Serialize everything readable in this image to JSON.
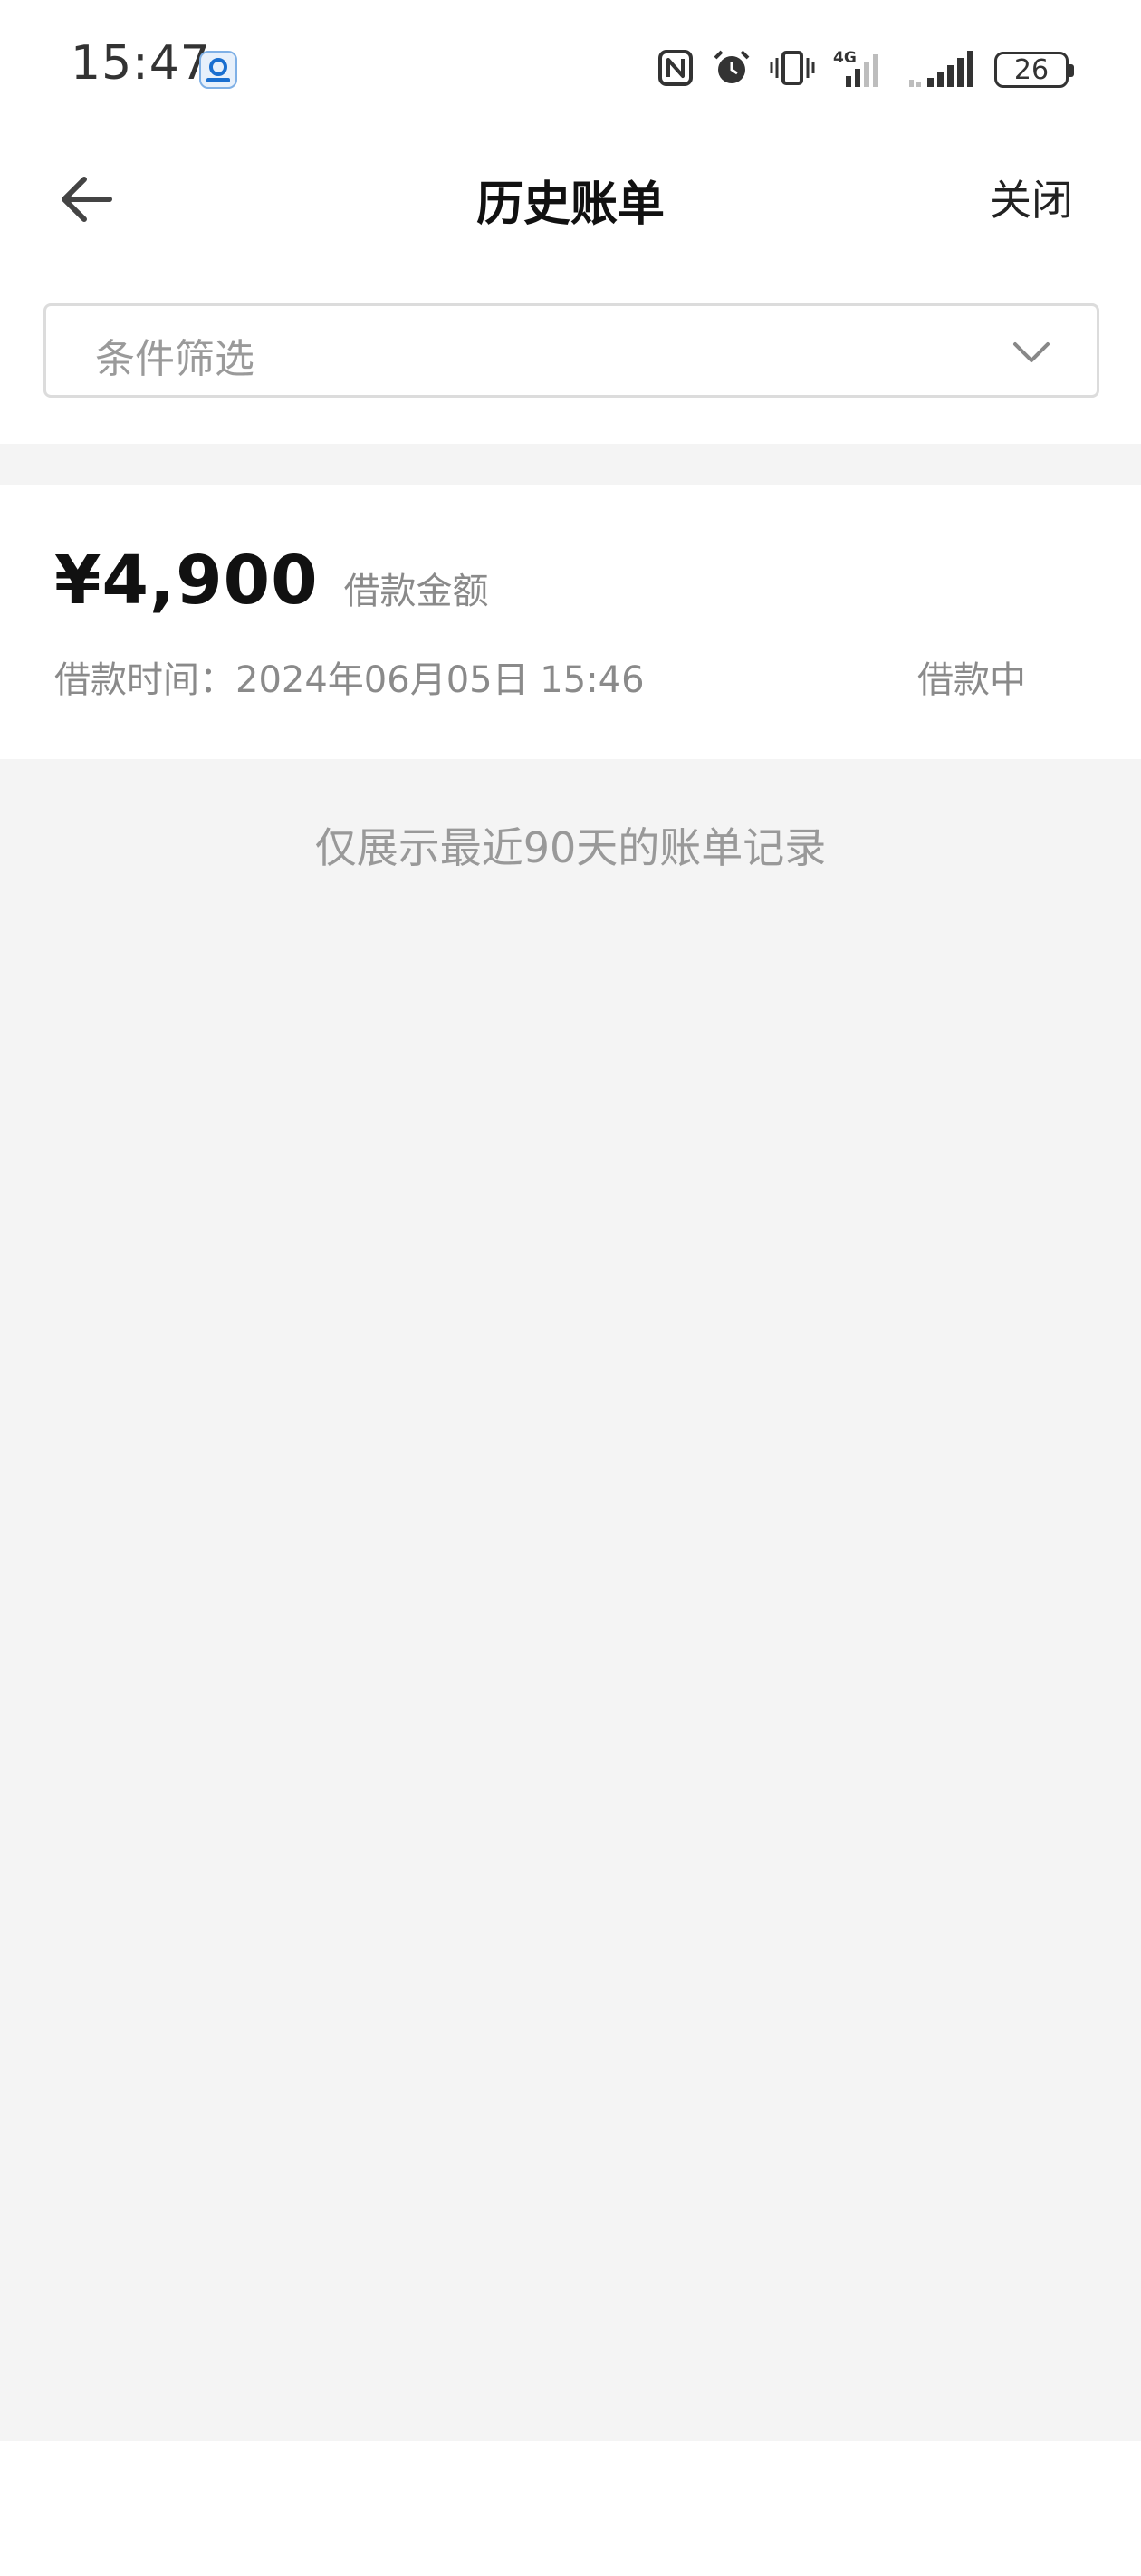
{
  "status_bar": {
    "time": "15:47",
    "battery": "26",
    "network": "4G",
    "icons": [
      "app-badge-icon",
      "nfc-icon",
      "alarm-icon",
      "vibrate-icon",
      "4g-signal-icon",
      "signal-icon",
      "battery-icon"
    ]
  },
  "header": {
    "title": "历史账单",
    "close_label": "关闭",
    "back_icon": "arrow-left-icon"
  },
  "filter": {
    "placeholder": "条件筛选",
    "icon": "chevron-down-icon"
  },
  "records": [
    {
      "amount": "¥4,900",
      "amount_label": "借款金额",
      "time_text": "借款时间：2024年06月05日 15:46",
      "status": "借款中"
    }
  ],
  "notice": "仅展示最近90天的账单记录",
  "colors": {
    "background": "#f4f4f4",
    "card": "#ffffff",
    "muted_text": "#8a8a8a",
    "primary_text": "#111111"
  }
}
